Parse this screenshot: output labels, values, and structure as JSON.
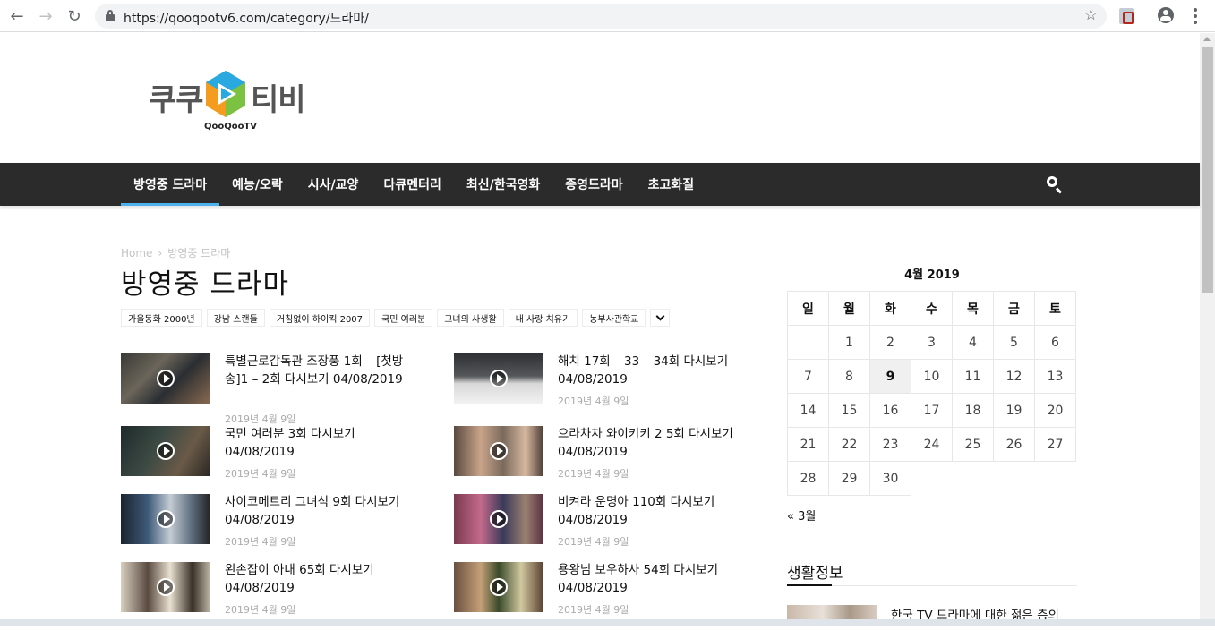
{
  "browser": {
    "url": "https://qooqootv6.com/category/드라마/"
  },
  "logo": {
    "left_text": "쿠쿠",
    "right_text": "티비",
    "sub_text": "QooQooTV"
  },
  "nav": {
    "items": [
      {
        "label": "방영중 드라마",
        "active": true
      },
      {
        "label": "예능/오락"
      },
      {
        "label": "시사/교양"
      },
      {
        "label": "다큐멘터리"
      },
      {
        "label": "최신/한국영화"
      },
      {
        "label": "종영드라마"
      },
      {
        "label": "초고화질"
      }
    ]
  },
  "breadcrumb": {
    "home": "Home",
    "separator": "›",
    "current": "방영중 드라마"
  },
  "page_title": "방영중 드라마",
  "tags": [
    "가을동화 2000년",
    "강남 스캔들",
    "거침없이 하이킥 2007",
    "국민 여러분",
    "그녀의 사생활",
    "내 사랑 치유기",
    "농부사관학교"
  ],
  "posts": [
    {
      "title": "특별근로감독관 조장풍 1회 – [첫방송]1 – 2회 다시보기 04/08/2019",
      "date": "2019년 4월 9일"
    },
    {
      "title": "해치 17회 – 33 – 34회 다시보기 04/08/2019",
      "date": "2019년 4월 9일"
    },
    {
      "title": "국민 여러분 3회 다시보기 04/08/2019",
      "date": "2019년 4월 9일"
    },
    {
      "title": "으라차차 와이키키 2 5회 다시보기 04/08/2019",
      "date": "2019년 4월 9일"
    },
    {
      "title": "사이코메트리 그녀석 9회 다시보기 04/08/2019",
      "date": "2019년 4월 9일"
    },
    {
      "title": "비켜라 운명아 110회 다시보기 04/08/2019",
      "date": "2019년 4월 9일"
    },
    {
      "title": "왼손잡이 아내 65회 다시보기 04/08/2019",
      "date": "2019년 4월 9일"
    },
    {
      "title": "용왕님 보우하사 54회 다시보기 04/08/2019",
      "date": "2019년 4월 9일"
    }
  ],
  "calendar": {
    "caption": "4월 2019",
    "weekdays": [
      "일",
      "월",
      "화",
      "수",
      "목",
      "금",
      "토"
    ],
    "rows": [
      [
        "",
        "1",
        "2",
        "3",
        "4",
        "5",
        "6"
      ],
      [
        "7",
        "8",
        "9",
        "10",
        "11",
        "12",
        "13"
      ],
      [
        "14",
        "15",
        "16",
        "17",
        "18",
        "19",
        "20"
      ],
      [
        "21",
        "22",
        "23",
        "24",
        "25",
        "26",
        "27"
      ],
      [
        "28",
        "29",
        "30",
        "",
        "",
        "",
        ""
      ]
    ],
    "today": "9",
    "prev_link": "« 3월"
  },
  "widget": {
    "title": "생활정보",
    "post_title": "한국 TV 드라마에 대한 젊은 층의"
  },
  "colors": {
    "nav_bg": "#2b2b2b",
    "accent": "#4db2ec",
    "logo_orange": "#f39c1f",
    "logo_blue": "#29a9e0",
    "logo_green": "#7cc242"
  }
}
